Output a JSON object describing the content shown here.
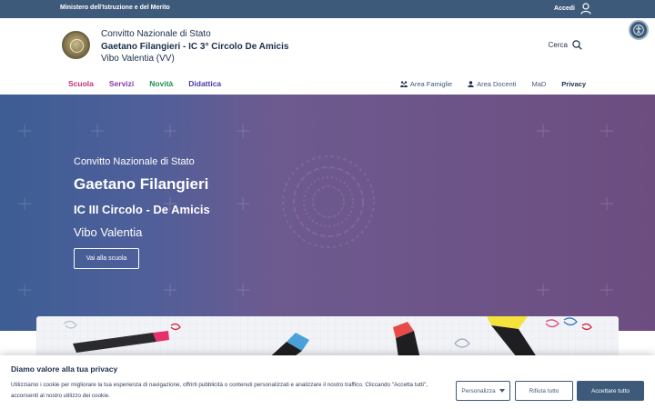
{
  "topbar": {
    "ministry": "Ministero dell'Istruzione e del Merito",
    "login_label": "Accedi",
    "login_icon": "user-icon"
  },
  "header": {
    "line1": "Convitto Nazionale di Stato",
    "line2": "Gaetano Filangieri - IC 3° Circolo De Amicis",
    "line3": "Vibo Valentia (VV)",
    "search_label": "Cerca",
    "search_icon": "search-icon",
    "accessibility_icon": "accessibility-icon"
  },
  "nav": {
    "main": [
      {
        "label": "Scuola",
        "color": "#c42f6b"
      },
      {
        "label": "Servizi",
        "color": "#8a3aa6"
      },
      {
        "label": "Novità",
        "color": "#1e8f4d"
      },
      {
        "label": "Didattica",
        "color": "#4a3aa6"
      }
    ],
    "utility": [
      {
        "label": "Area Famiglie",
        "icon": "family-icon"
      },
      {
        "label": "Area Docenti",
        "icon": "teacher-icon"
      },
      {
        "label": "MaD"
      },
      {
        "label": "Privacy"
      }
    ]
  },
  "hero": {
    "line1": "Convitto Nazionale di Stato",
    "line2": "Gaetano Filangieri",
    "line3": "IC III Circolo - De Amicis",
    "line4": "Vibo Valentia",
    "cta": "Vai alla scuola"
  },
  "cookie": {
    "title": "Diamo valore alla tua privacy",
    "message": "Utilizziamo i cookie per migliorare la tua esperienza di navigazione, offrirti pubblicità o contenuti personalizzati e analizzare il nostro traffico. Cliccando \"Accetta tutti\", acconsenti al nostro utilizzo dei cookie.",
    "personalize": "Personalizza",
    "reject": "Rifiuta tutto",
    "accept": "Accettare tutto"
  },
  "colors": {
    "primary": "#3e5a7a",
    "hero_start": "#3d5d94",
    "hero_end": "#6d4d80"
  }
}
